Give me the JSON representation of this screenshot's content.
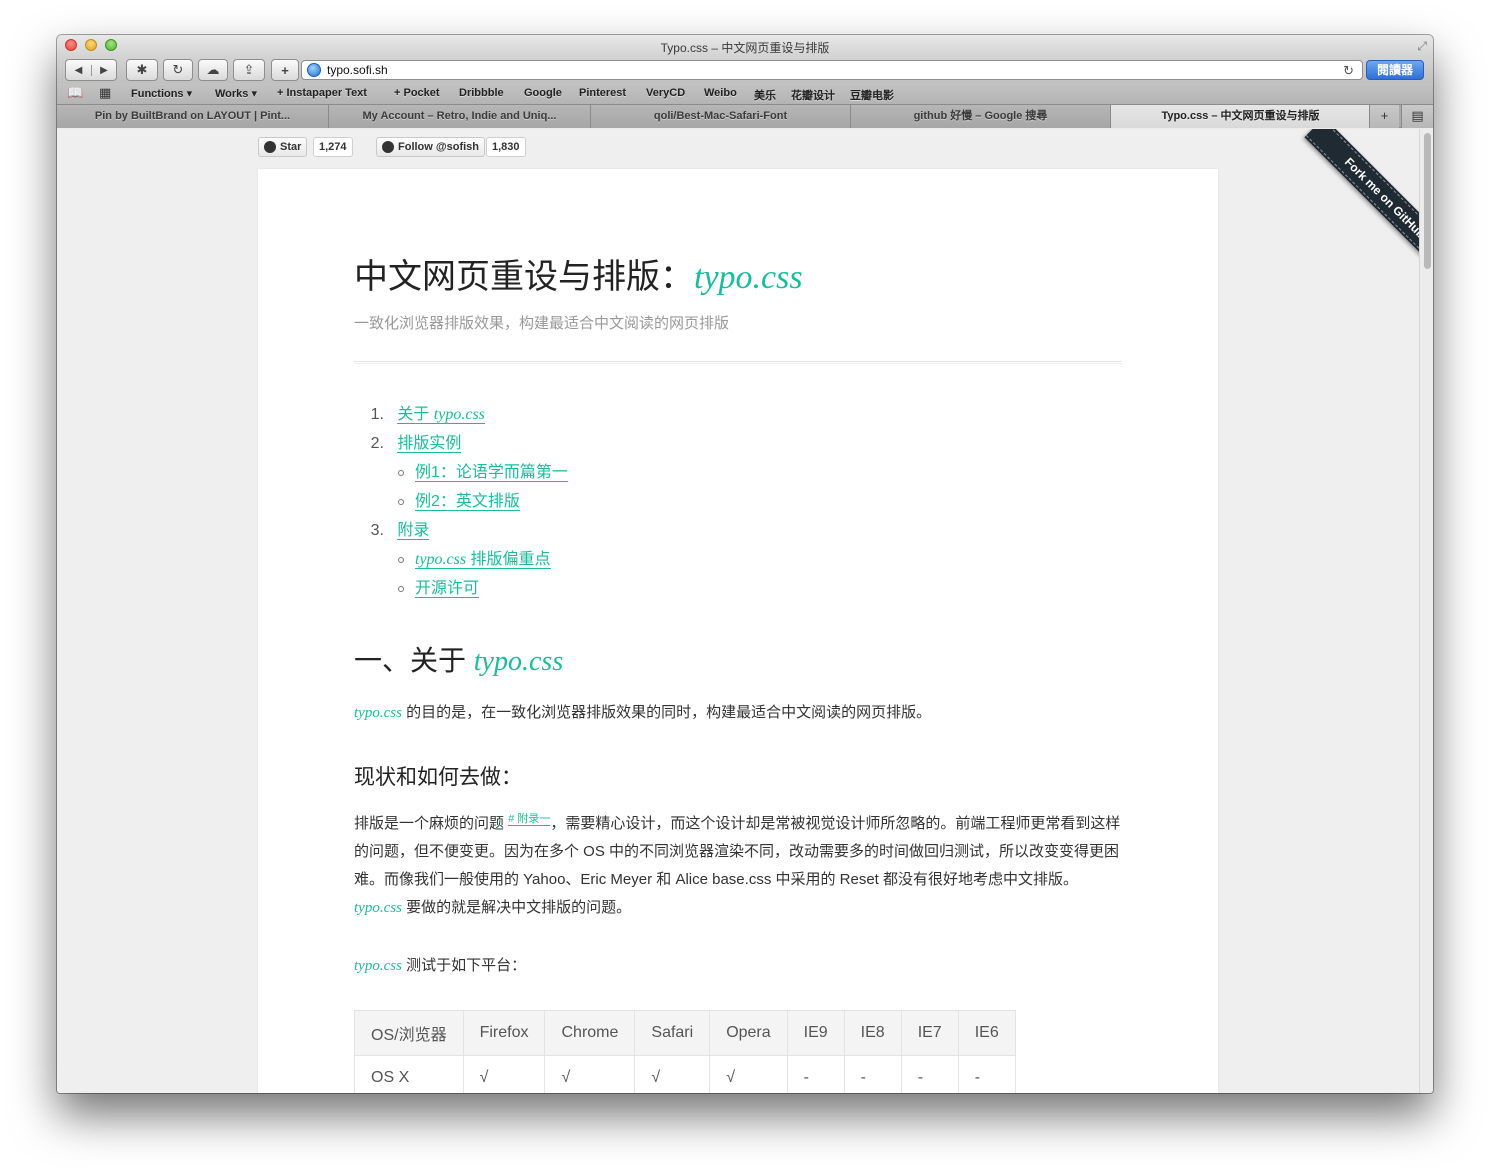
{
  "window": {
    "title": "Typo.css – 中文网页重设与排版"
  },
  "toolbar": {
    "back_icon": "back-arrow-icon",
    "forward_icon": "forward-arrow-icon",
    "url": "typo.sofi.sh",
    "reader_label": "閱讀器"
  },
  "bookmarks": [
    "Functions ▾",
    "Works ▾",
    "+ Instapaper Text",
    "+ Pocket",
    "Dribbble",
    "Google",
    "Pinterest",
    "VeryCD",
    "Weibo",
    "美乐",
    "花瓣设计",
    "豆瓣电影"
  ],
  "tabs": [
    {
      "label": "Pin by BuiltBrand on LAYOUT | Pint..."
    },
    {
      "label": "My Account – Retro, Indie and Uniq..."
    },
    {
      "label": "qoli/Best-Mac-Safari-Font"
    },
    {
      "label": "github 好慢 – Google 搜尋"
    },
    {
      "label": "Typo.css – 中文网页重设与排版"
    }
  ],
  "github": {
    "star_label": "Star",
    "star_count": "1,274",
    "follow_label": "Follow @sofish",
    "follow_count": "1,830",
    "ribbon": "Fork me on GitHub"
  },
  "article": {
    "title_cn": "中文网页重设与排版：",
    "title_typo": "typo.css",
    "subtitle": "一致化浏览器排版效果，构建最适合中文阅读的网页排版",
    "toc": {
      "i1_num": "1.",
      "i1_pre": "关于 ",
      "i1_typo": "typo.css",
      "i2_num": "2.",
      "i2": "排版实例",
      "i2a": "例1：论语学而篇第一",
      "i2b": "例2：英文排版",
      "i3_num": "3.",
      "i3": "附录",
      "i3a_typo": "typo.css",
      "i3a_rest": " 排版偏重点",
      "i3b": "开源许可"
    },
    "h2_pre": "一、关于 ",
    "h2_typo": "typo.css",
    "intro_typo": "typo.css",
    "intro_rest": " 的目的是，在一致化浏览器排版效果的同时，构建最适合中文阅读的网页排版。",
    "h3": "现状和如何去做：",
    "p1_a": "排版是一个麻烦的问题 ",
    "p1_sup": "# 附录一",
    "p1_b": "，需要精心设计，而这个设计却是常被视觉设计师所忽略的。前端工程师更常看到这样的问题，但不便变更。因为在多个 OS 中的不同浏览器渲染不同，改动需要多的时间做回归测试，所以改变变得更困难。而像我们一般使用的 Yahoo、Eric Meyer 和 Alice base.css 中采用的 Reset 都没有很好地考虑中文排版。",
    "p1_typo": "typo.css",
    "p1_c": " 要做的就是解决中文排版的问题。",
    "test_typo": "typo.css",
    "test_rest": " 测试于如下平台：",
    "table": {
      "headers": [
        "OS/浏览器",
        "Firefox",
        "Chrome",
        "Safari",
        "Opera",
        "IE9",
        "IE8",
        "IE7",
        "IE6"
      ],
      "rows": [
        [
          "OS X",
          "√",
          "√",
          "√",
          "√",
          "-",
          "-",
          "-",
          "-"
        ]
      ]
    }
  }
}
